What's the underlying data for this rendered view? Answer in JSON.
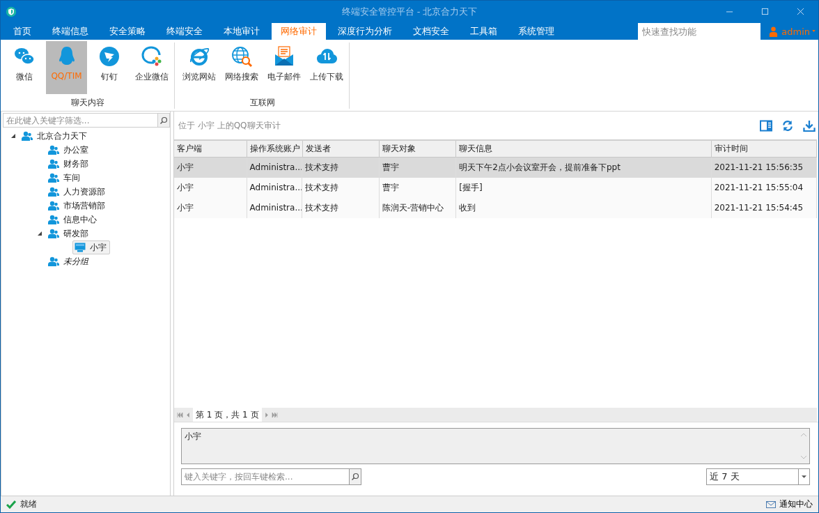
{
  "window": {
    "title": "终端安全管控平台 - 北京合力天下"
  },
  "menu": [
    {
      "label": "首页",
      "selected": false
    },
    {
      "label": "终端信息",
      "selected": false
    },
    {
      "label": "安全策略",
      "selected": false
    },
    {
      "label": "终端安全",
      "selected": false
    },
    {
      "label": "本地审计",
      "selected": false
    },
    {
      "label": "网络审计",
      "selected": true
    },
    {
      "label": "深度行为分析",
      "selected": false
    },
    {
      "label": "文档安全",
      "selected": false
    },
    {
      "label": "工具箱",
      "selected": false
    },
    {
      "label": "系统管理",
      "selected": false
    }
  ],
  "quick_search": {
    "placeholder": "快速查找功能"
  },
  "user": {
    "name": "admin"
  },
  "ribbon": [
    {
      "label": "聊天内容",
      "items": [
        {
          "label": "微信",
          "kind": "wechat",
          "selected": false
        },
        {
          "label": "QQ/TIM",
          "kind": "qq",
          "selected": true
        },
        {
          "label": "钉钉",
          "kind": "dingtalk",
          "selected": false
        },
        {
          "label": "企业微信",
          "kind": "wecom",
          "selected": false
        }
      ]
    },
    {
      "label": "互联网",
      "items": [
        {
          "label": "浏览网站",
          "kind": "browser",
          "selected": false
        },
        {
          "label": "网络搜索",
          "kind": "search",
          "selected": false
        },
        {
          "label": "电子邮件",
          "kind": "mail",
          "selected": false
        },
        {
          "label": "上传下载",
          "kind": "transfer",
          "selected": false
        }
      ]
    }
  ],
  "tree_filter": {
    "placeholder": "在此键入关键字筛选..."
  },
  "tree": [
    {
      "label": "北京合力天下",
      "kind": "group",
      "expanded": true,
      "selected": false,
      "children": [
        {
          "label": "办公室",
          "kind": "group",
          "selected": false
        },
        {
          "label": "财务部",
          "kind": "group",
          "selected": false
        },
        {
          "label": "车间",
          "kind": "group",
          "selected": false
        },
        {
          "label": "人力资源部",
          "kind": "group",
          "selected": false
        },
        {
          "label": "市场营销部",
          "kind": "group",
          "selected": false
        },
        {
          "label": "信息中心",
          "kind": "group",
          "selected": false
        },
        {
          "label": "研发部",
          "kind": "group",
          "expanded": true,
          "selected": false,
          "children": [
            {
              "label": "小宇",
              "kind": "computer",
              "selected": true
            }
          ]
        },
        {
          "label": "未分组",
          "kind": "ungrouped",
          "selected": false
        }
      ]
    }
  ],
  "panel": {
    "caption": "位于 小宇 上的QQ聊天审计"
  },
  "table": {
    "columns": [
      "客户端",
      "操作系统账户",
      "发送者",
      "聊天对象",
      "聊天信息",
      "审计时间"
    ],
    "rows": [
      {
        "cells": [
          "小宇",
          "Administra...",
          "技术支持",
          "曹宇",
          "明天下午2点小会议室开会，提前准备下ppt",
          "2021-11-21 15:56:35"
        ],
        "selected": true
      },
      {
        "cells": [
          "小宇",
          "Administra...",
          "技术支持",
          "曹宇",
          "[握手]",
          "2021-11-21 15:55:04"
        ],
        "selected": false
      },
      {
        "cells": [
          "小宇",
          "Administra...",
          "技术支持",
          "陈润天-营销中心",
          "收到",
          "2021-11-21 15:54:45"
        ],
        "selected": false
      }
    ]
  },
  "pager": {
    "text": "第 1 页，共 1 页"
  },
  "detail": {
    "text": "小宇"
  },
  "keyword_search": {
    "placeholder": "键入关键字，按回车键检索..."
  },
  "period": {
    "value": "近 7 天"
  },
  "status_bar": {
    "status": "就绪",
    "notifications": "通知中心"
  }
}
